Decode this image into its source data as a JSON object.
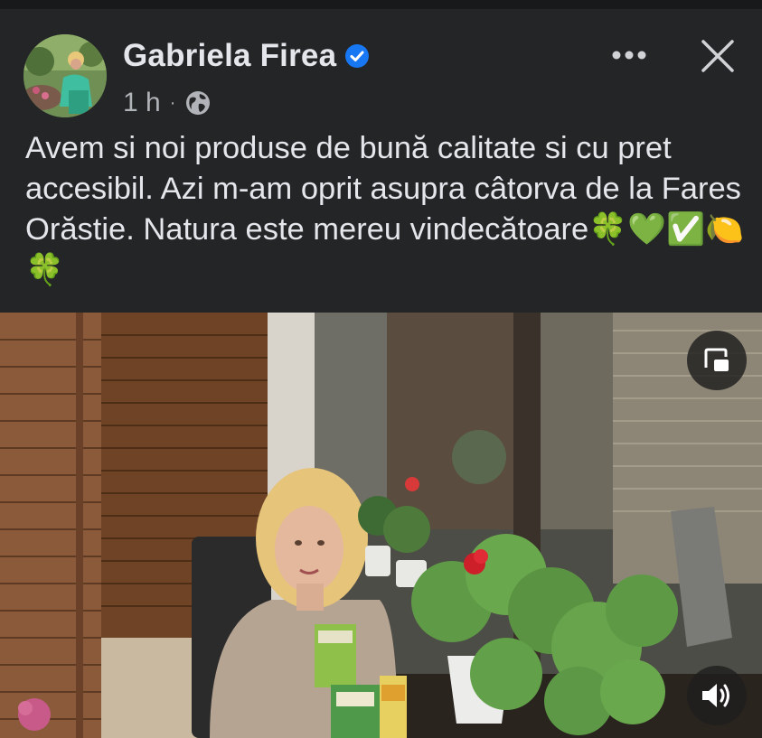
{
  "post": {
    "author": "Gabriela Firea",
    "time": "1 h",
    "separator": "·",
    "text": "Avem si noi produse de bună calitate si cu pret accesibil. Azi m-am oprit asupra câtorva de la Fares Orăstie. Natura este mereu vindecătoare🍀💚✅🍋🍀"
  },
  "icons": {
    "verified": "verified-badge-icon",
    "audience": "globe-icon",
    "more": "more-options-icon",
    "close": "close-icon",
    "pip": "picture-in-picture-icon",
    "sound": "speaker-icon"
  },
  "colors": {
    "background": "#242526",
    "text": "#e4e6eb",
    "secondary_text": "#b0b3b8",
    "verified_blue": "#1877f2"
  }
}
